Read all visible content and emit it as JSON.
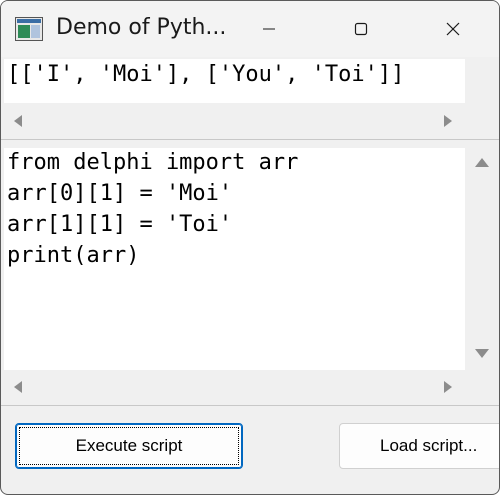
{
  "window": {
    "title": "Demo of Pyth..."
  },
  "output": {
    "text": "[['I', 'Moi'], ['You', 'Toi']]"
  },
  "editor": {
    "lines": [
      "from delphi import arr",
      "arr[0][1] = 'Moi'",
      "arr[1][1] = 'Toi'",
      "print(arr)"
    ]
  },
  "buttons": {
    "execute_label": "Execute script",
    "load_label": "Load script..."
  },
  "icons": {
    "app": "app-icon",
    "minimize": "minimize-icon",
    "maximize": "maximize-icon",
    "close": "close-icon"
  },
  "colors": {
    "accent": "#0067c0",
    "scroll_arrow": "#8c8c8c"
  }
}
